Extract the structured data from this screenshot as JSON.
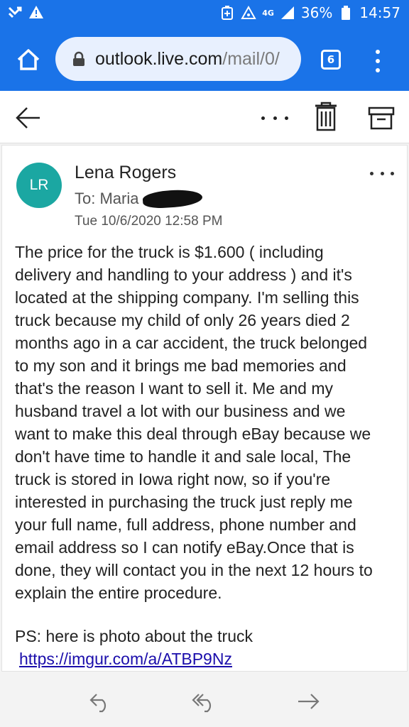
{
  "status_bar": {
    "network": "4G",
    "battery_percent": "36%",
    "time": "14:57",
    "icons": [
      "missed-call-icon",
      "warning-icon",
      "battery-saver-icon",
      "hotspot-icon",
      "signal-icon",
      "battery-icon"
    ]
  },
  "browser": {
    "url_domain": "outlook.live.com",
    "url_path": "/mail/0/",
    "tab_count": "6",
    "accent_color": "#1a73e8"
  },
  "toolbar": {
    "icons": [
      "back-arrow-icon",
      "more-options-icon",
      "delete-icon",
      "archive-icon"
    ]
  },
  "message": {
    "avatar_initials": "LR",
    "avatar_color": "#1ba7a2",
    "sender": "Lena Rogers",
    "to_label": "To: Maria",
    "date": "Tue 10/6/2020 12:58 PM",
    "body": "The price for the truck is $1.600 ( including\ndelivery and handling to your address ) and it's\nlocated at the shipping company. I'm selling this\ntruck because my child of only 26 years died 2\nmonths ago in a car accident, the truck belonged\nto my son and it brings me bad memories and\nthat's the reason I want to sell it. Me and my\nhusband travel a lot with our business and we\nwant to make this deal through eBay because we\ndon't have time to handle it and sale local, The\ntruck is stored in Iowa right now, so if you're\ninterested in purchasing the  truck just reply me\nyour full name, full address, phone number and\nemail address so I can notify eBay.Once that is\ndone, they will contact you in the next 12 hours to\nexplain the entire procedure.",
    "ps": "PS: here is photo about the truck",
    "link": "https://imgur.com/a/ATBP9Nz",
    "link_color": "#1a0dab"
  },
  "bottom_bar": {
    "icons": [
      "reply-icon",
      "reply-all-icon",
      "forward-icon"
    ]
  }
}
